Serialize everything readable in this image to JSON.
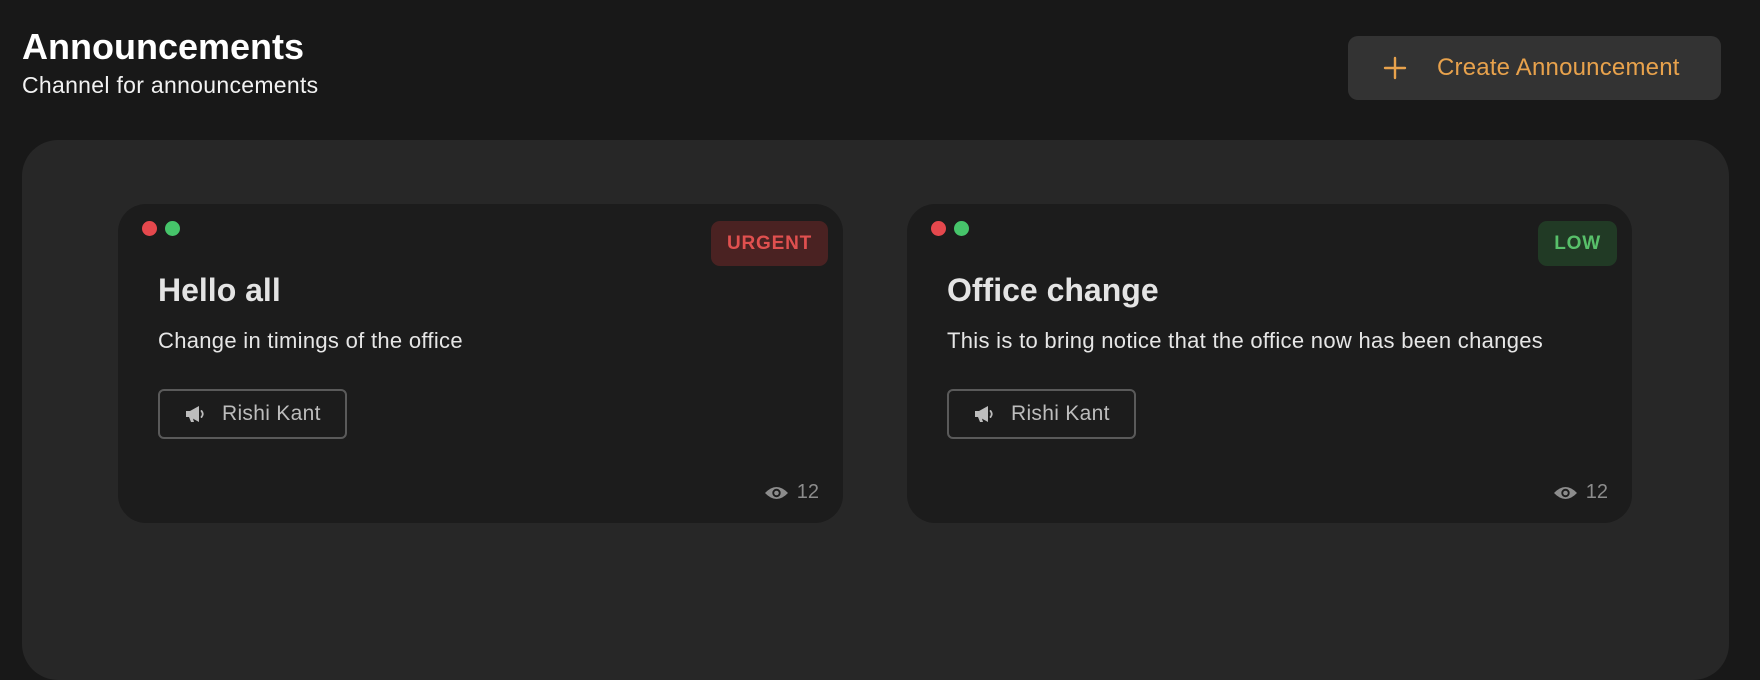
{
  "header": {
    "title": "Announcements",
    "subtitle": "Channel for announcements"
  },
  "create_button": {
    "label": "Create Announcement",
    "icon": "plus-icon"
  },
  "colors": {
    "accent": "#e8a24c",
    "urgent": "#e0504f",
    "low": "#58c06a",
    "dot_red": "#e5484d",
    "dot_green": "#46c46a"
  },
  "announcements": [
    {
      "priority": "URGENT",
      "title": "Hello all",
      "description": "Change in timings of the office",
      "author": "Rishi Kant",
      "views": "12",
      "author_icon": "megaphone-icon",
      "views_icon": "eye-icon"
    },
    {
      "priority": "LOW",
      "title": "Office change",
      "description": "This is to bring notice that the office now has been changes",
      "author": "Rishi Kant",
      "views": "12",
      "author_icon": "megaphone-icon",
      "views_icon": "eye-icon"
    }
  ]
}
